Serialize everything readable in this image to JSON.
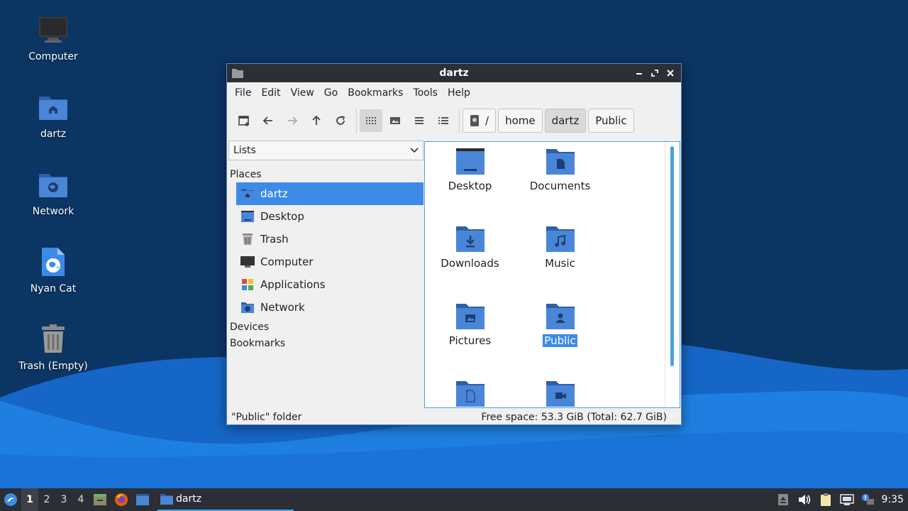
{
  "desktop": {
    "icons": [
      {
        "label": "Computer"
      },
      {
        "label": "dartz"
      },
      {
        "label": "Network"
      },
      {
        "label": "Nyan Cat"
      },
      {
        "label": "Trash (Empty)"
      }
    ]
  },
  "window": {
    "title": "dartz",
    "menu": [
      "File",
      "Edit",
      "View",
      "Go",
      "Bookmarks",
      "Tools",
      "Help"
    ],
    "path": {
      "root": "/",
      "segments": [
        "home",
        "dartz",
        "Public"
      ],
      "current": "dartz"
    },
    "sidepane": {
      "selector_value": "Lists",
      "places_heading": "Places",
      "places": [
        "dartz",
        "Desktop",
        "Trash",
        "Computer",
        "Applications",
        "Network"
      ],
      "selected_place": "dartz",
      "devices_heading": "Devices",
      "bookmarks_heading": "Bookmarks"
    },
    "files": [
      {
        "name": "Desktop",
        "icon": "desktop-folder-icon"
      },
      {
        "name": "Documents",
        "icon": "documents-folder-icon"
      },
      {
        "name": "Downloads",
        "icon": "downloads-folder-icon"
      },
      {
        "name": "Music",
        "icon": "music-folder-icon"
      },
      {
        "name": "Pictures",
        "icon": "pictures-folder-icon"
      },
      {
        "name": "Public",
        "icon": "public-folder-icon"
      },
      {
        "name": "",
        "icon": "templates-folder-icon"
      },
      {
        "name": "",
        "icon": "videos-folder-icon"
      }
    ],
    "selected_file": "Public",
    "status": {
      "left": "\"Public\" folder",
      "right": "Free space: 53.3 GiB (Total: 62.7 GiB)"
    }
  },
  "taskbar": {
    "workspaces": [
      "1",
      "2",
      "3",
      "4"
    ],
    "active_workspace": "1",
    "task_label": "dartz",
    "clock": "9:35"
  },
  "colors": {
    "accent": "#3d8be6",
    "folder": "#4a86d8",
    "folder_dark": "#2e5fa8",
    "titlebar": "#2b2f38",
    "taskbar": "#2b2e35"
  }
}
